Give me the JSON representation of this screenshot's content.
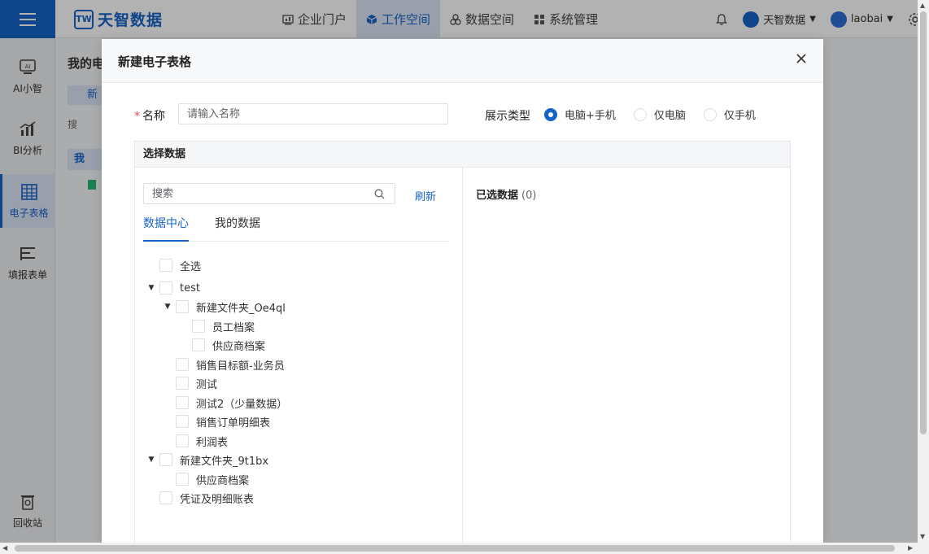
{
  "app": {
    "logo_text": "天智数据",
    "logo_mark": "TW"
  },
  "nav": [
    {
      "label": "企业门户",
      "icon": "chart-icon"
    },
    {
      "label": "工作空间",
      "icon": "cube-icon"
    },
    {
      "label": "数据空间",
      "icon": "cubes-icon"
    },
    {
      "label": "系统管理",
      "icon": "grid-icon"
    }
  ],
  "header": {
    "org_name": "天智数据",
    "user_name": "laobai"
  },
  "sidebar": {
    "items": [
      {
        "label": "AI小智",
        "icon": "ai-icon"
      },
      {
        "label": "BI分析",
        "icon": "bar-chart-icon"
      },
      {
        "label": "电子表格",
        "icon": "spreadsheet-icon"
      },
      {
        "label": "填报表单",
        "icon": "form-icon"
      },
      {
        "label": "回收站",
        "icon": "recycle-bin-icon"
      }
    ]
  },
  "background": {
    "title": "我的电",
    "new_button": "新",
    "search": "搜",
    "row": "我"
  },
  "dialog": {
    "title": "新建电子表格",
    "name_label": "名称",
    "name_required_mark": "*",
    "name_placeholder": "请输入名称",
    "display_type_label": "展示类型",
    "display_options": [
      "电脑+手机",
      "仅电脑",
      "仅手机"
    ],
    "display_selected": "电脑+手机",
    "select_data_title": "选择数据",
    "search_placeholder": "搜索",
    "refresh_label": "刷新",
    "tabs": [
      "数据中心",
      "我的数据"
    ],
    "active_tab": "数据中心",
    "tree": [
      {
        "label": "全选",
        "level": 0,
        "toggle": ""
      },
      {
        "label": "test",
        "level": 0,
        "toggle": "▼"
      },
      {
        "label": "新建文件夹_Oe4ql",
        "level": 1,
        "toggle": "▼"
      },
      {
        "label": "员工档案",
        "level": 2,
        "toggle": ""
      },
      {
        "label": "供应商档案",
        "level": 2,
        "toggle": ""
      },
      {
        "label": "销售目标额-业务员",
        "level": 1,
        "toggle": ""
      },
      {
        "label": "测试",
        "level": 1,
        "toggle": ""
      },
      {
        "label": "测试2（少量数据）",
        "level": 1,
        "toggle": ""
      },
      {
        "label": "销售订单明细表",
        "level": 1,
        "toggle": ""
      },
      {
        "label": "利润表",
        "level": 1,
        "toggle": ""
      },
      {
        "label": "新建文件夹_9t1bx",
        "level": 0,
        "toggle": "▼"
      },
      {
        "label": "供应商档案",
        "level": 1,
        "toggle": ""
      },
      {
        "label": "凭证及明细账表",
        "level": 0,
        "toggle": ""
      }
    ],
    "selected_title": "已选数据",
    "selected_count": "(0)"
  },
  "colors": {
    "accent": "#1664c8",
    "active_bg": "#dbe6f5",
    "required": "#e5484d"
  }
}
